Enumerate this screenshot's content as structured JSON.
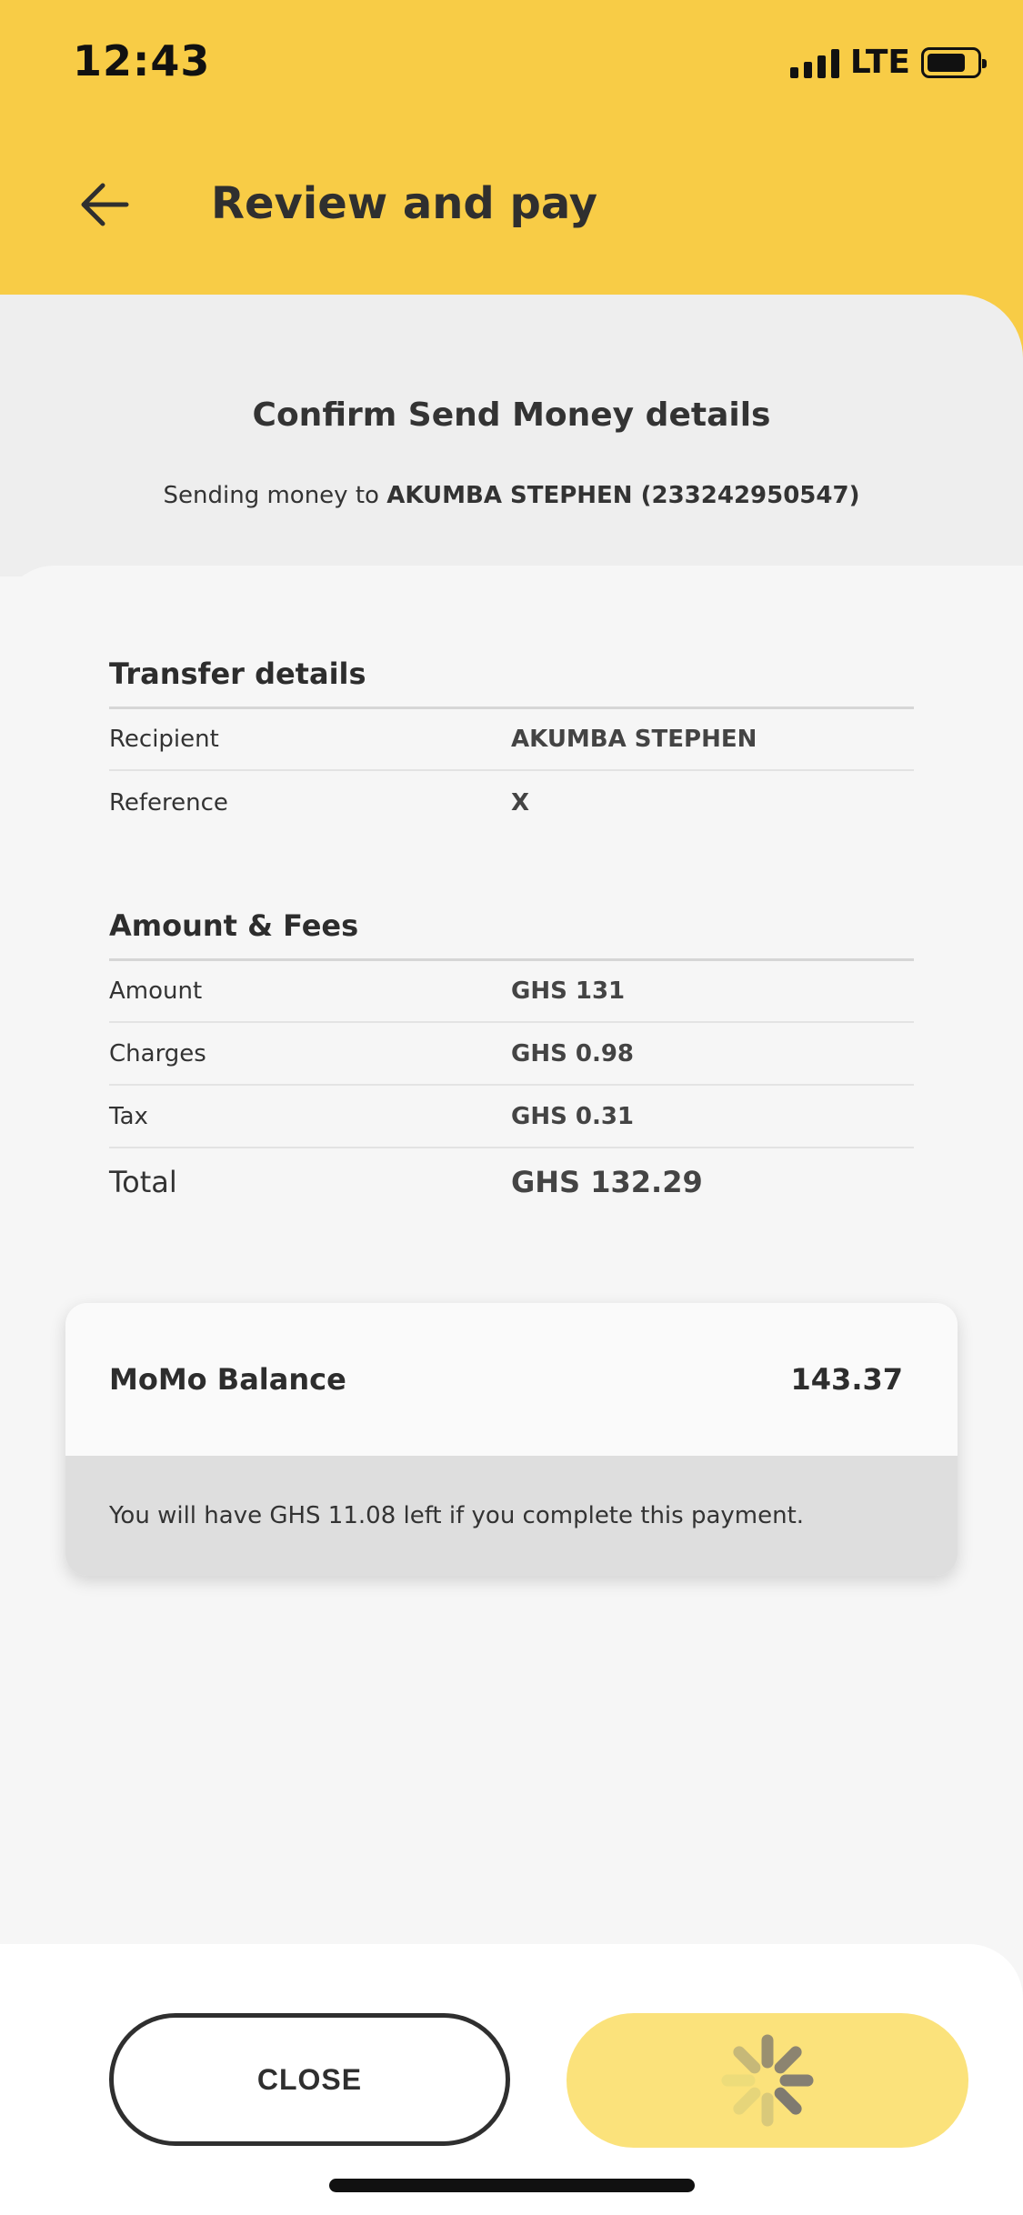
{
  "status_bar": {
    "time": "12:43",
    "network": "LTE"
  },
  "header": {
    "title": "Review and pay",
    "back_icon": "arrow-left-icon"
  },
  "confirm": {
    "title": "Confirm Send Money details",
    "sending_prefix": "Sending money to",
    "recipient_full": "AKUMBA STEPHEN (233242950547)"
  },
  "transfer_details": {
    "title": "Transfer details",
    "rows": [
      {
        "label": "Recipient",
        "value": "AKUMBA STEPHEN"
      },
      {
        "label": "Reference",
        "value": "X"
      }
    ]
  },
  "amount_fees": {
    "title": "Amount & Fees",
    "rows": [
      {
        "label": "Amount",
        "value": "GHS 131"
      },
      {
        "label": "Charges",
        "value": "GHS 0.98"
      },
      {
        "label": "Tax",
        "value": "GHS 0.31"
      }
    ],
    "total": {
      "label": "Total",
      "value": "GHS 132.29"
    }
  },
  "balance": {
    "label": "MoMo Balance",
    "value": "143.37",
    "note": "You will have GHS 11.08 left if you complete this payment."
  },
  "footer": {
    "close_label": "CLOSE",
    "pay_icon": "loading-spinner-icon"
  },
  "colors": {
    "brand_yellow": "#f8cc46",
    "pay_button_disabled": "#fbe27b"
  }
}
